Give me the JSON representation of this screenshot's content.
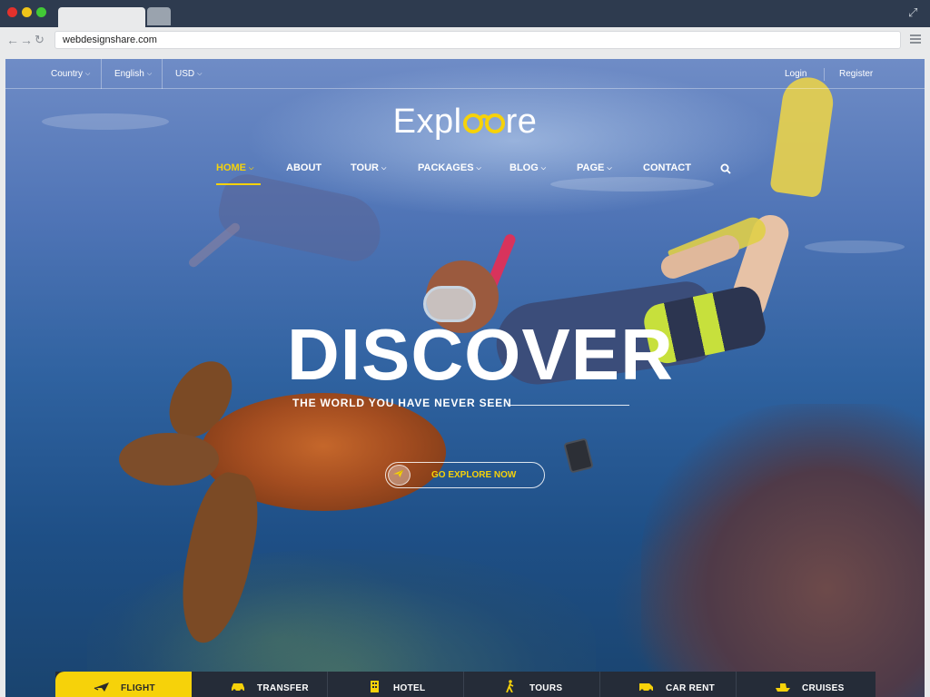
{
  "browser": {
    "url": "webdesignshare.com"
  },
  "topbar": {
    "country": "Country",
    "language": "English",
    "currency": "USD",
    "login": "Login",
    "register": "Register"
  },
  "logo": {
    "prefix": "Expl",
    "suffix": "re"
  },
  "nav": {
    "items": [
      {
        "label": "HOME",
        "dropdown": true,
        "active": true
      },
      {
        "label": "ABOUT",
        "dropdown": false
      },
      {
        "label": "TOUR",
        "dropdown": true
      },
      {
        "label": "PACKAGES",
        "dropdown": true
      },
      {
        "label": "BLOG",
        "dropdown": true
      },
      {
        "label": "PAGE",
        "dropdown": true
      },
      {
        "label": "CONTACT",
        "dropdown": false
      }
    ]
  },
  "hero": {
    "headline": "DISCOVER",
    "subline": "THE WORLD YOU HAVE NEVER SEEN",
    "cta": "GO EXPLORE NOW"
  },
  "booking_tabs": [
    {
      "label": "FLIGHT",
      "icon": "plane-icon",
      "active": true
    },
    {
      "label": "TRANSFER",
      "icon": "car-icon"
    },
    {
      "label": "HOTEL",
      "icon": "building-icon"
    },
    {
      "label": "TOURS",
      "icon": "person-walking-icon"
    },
    {
      "label": "CAR RENT",
      "icon": "van-icon"
    },
    {
      "label": "CRUISES",
      "icon": "ship-icon"
    }
  ],
  "colors": {
    "accent": "#f6d20a",
    "tab_bar": "#252c38",
    "chrome": "#2e3b4f"
  }
}
